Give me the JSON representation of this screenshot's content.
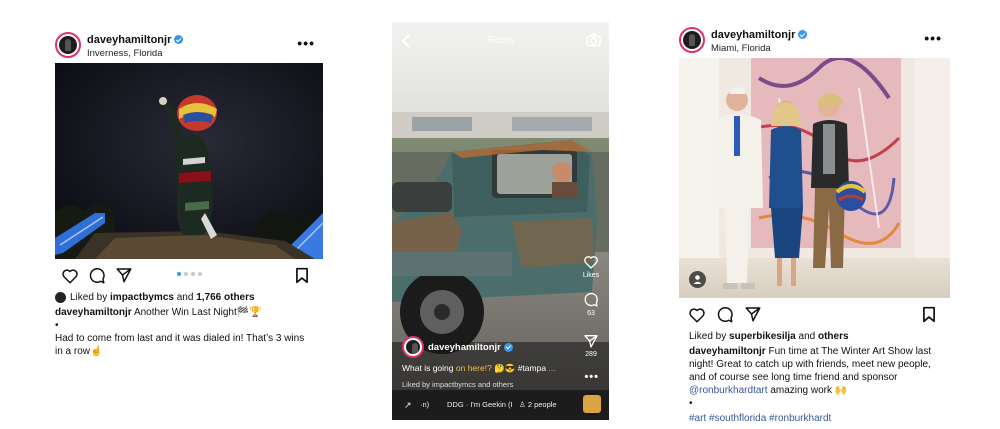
{
  "posts": [
    {
      "username": "daveyhamiltonjr",
      "location": "Inverness, Florida",
      "more": "•••",
      "liked_prefix": "Liked by",
      "liked_user": "impactbymcs",
      "liked_mid": "and",
      "liked_count": "1,766 others",
      "caption_user": "daveyhamiltonjr",
      "caption_text": "Another Win Last Night🏁🏆",
      "caption_dot": "•",
      "caption_body": "Had to come from last and it was dialed in! That’s 3 wins in a row☝️",
      "carousel_total": 4,
      "carousel_active": 1
    },
    {
      "username": "daveyhamiltonjr",
      "location": "Miami, Florida",
      "more": "•••",
      "liked_prefix": "Liked by",
      "liked_user": "superbikesilja",
      "liked_mid": "and",
      "liked_count": "others",
      "caption_user": "daveyhamiltonjr",
      "caption_text": "Fun time at The Winter Art Show last night! Great to catch up with friends, meet new people, and of course see long time friend and sponsor",
      "caption_mention": "@ronburkhardtart",
      "caption_after": "amazing work 🙌",
      "caption_dot": "•",
      "hashtags": "#art #southflorida #ronburkhardt"
    }
  ],
  "reel": {
    "title": "Reels",
    "username": "daveyhamiltonjr",
    "caption_start": "What is going",
    "caption_highlight": "on here!?",
    "caption_emoji": "🤔😎",
    "caption_tag": "#tampa",
    "caption_more": "...",
    "liked_prefix": "Liked by",
    "liked_user": "impactbymcs",
    "liked_suffix": "and others",
    "likes_label": "Likes",
    "comments": "63",
    "shares": "289",
    "more": "•••",
    "audio_arrow": "↗",
    "audio_frag": "·n)",
    "audio_track": "DDG · I'm Geekin (I",
    "people": "2 people"
  },
  "colors": {
    "verified": "#3897f0",
    "ring": "#e1306c",
    "link": "#385898",
    "carousel_active": "#3897f0"
  }
}
